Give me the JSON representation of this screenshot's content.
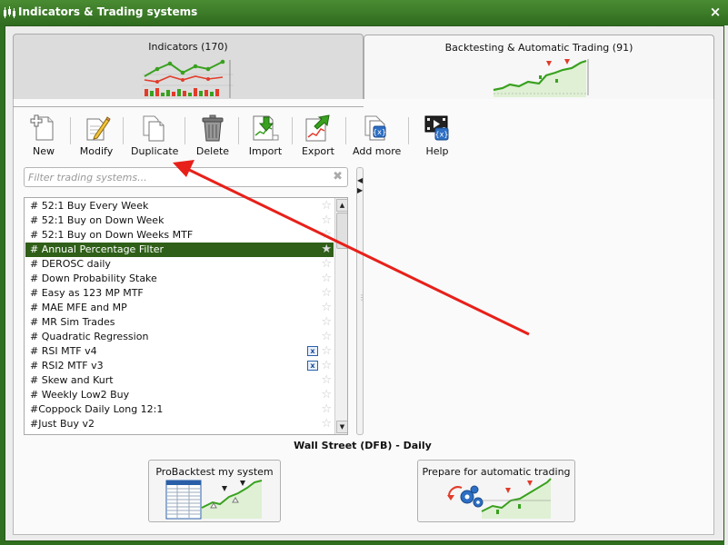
{
  "window": {
    "title": "Indicators & Trading systems",
    "close_glyph": "×"
  },
  "tabs": [
    {
      "label": "Indicators (170)",
      "selected": false
    },
    {
      "label": "Backtesting & Automatic Trading (91)",
      "selected": true
    }
  ],
  "toolbar": {
    "buttons": [
      {
        "label": "New",
        "icon": "new-icon"
      },
      {
        "label": "Modify",
        "icon": "pencil-icon"
      },
      {
        "label": "Duplicate",
        "icon": "duplicate-icon"
      },
      {
        "label": "Delete",
        "icon": "trash-icon"
      },
      {
        "label": "Import",
        "icon": "import-icon"
      },
      {
        "label": "Export",
        "icon": "export-icon"
      },
      {
        "label": "Add more",
        "icon": "add-more-icon"
      },
      {
        "label": "Help",
        "icon": "help-icon"
      }
    ]
  },
  "filter": {
    "placeholder": "Filter trading systems...",
    "value": "",
    "clear_glyph": "✖"
  },
  "systems": {
    "items": [
      {
        "name": "# 52:1 Buy Every Week",
        "automatic": false,
        "selected": false
      },
      {
        "name": "# 52:1 Buy on Down Week",
        "automatic": false,
        "selected": false
      },
      {
        "name": "# 52:1 Buy on Down Weeks MTF",
        "automatic": false,
        "selected": false
      },
      {
        "name": "# Annual Percentage Filter",
        "automatic": false,
        "selected": true
      },
      {
        "name": "# DEROSC daily",
        "automatic": false,
        "selected": false
      },
      {
        "name": "# Down Probability Stake",
        "automatic": false,
        "selected": false
      },
      {
        "name": "# Easy as 123 MP MTF",
        "automatic": false,
        "selected": false
      },
      {
        "name": "# MAE MFE and MP",
        "automatic": false,
        "selected": false
      },
      {
        "name": "# MR Sim Trades",
        "automatic": false,
        "selected": false
      },
      {
        "name": "# Quadratic Regression",
        "automatic": false,
        "selected": false
      },
      {
        "name": "# RSI MTF v4",
        "automatic": true,
        "selected": false
      },
      {
        "name": "# RSI2 MTF v3",
        "automatic": true,
        "selected": false
      },
      {
        "name": "# Skew and Kurt",
        "automatic": false,
        "selected": false
      },
      {
        "name": "# Weekly Low2 Buy",
        "automatic": false,
        "selected": false
      },
      {
        "name": "#Coppock Daily Long 12:1",
        "automatic": false,
        "selected": false
      },
      {
        "name": "#Just Buy v2",
        "automatic": false,
        "selected": false
      }
    ],
    "star_glyph": "☆",
    "selected_star_glyph": "★",
    "auto_badge_glyph": "⊠"
  },
  "instrument": {
    "label": "Wall Street (DFB) - Daily"
  },
  "actions": {
    "probacktest_label": "ProBacktest my system",
    "automatic_label": "Prepare for automatic trading"
  },
  "colors": {
    "window_green": "#2f6f1f",
    "selected_row": "#2f5f18",
    "chart_green": "#39a11f",
    "annotation_red": "#e8201a"
  }
}
